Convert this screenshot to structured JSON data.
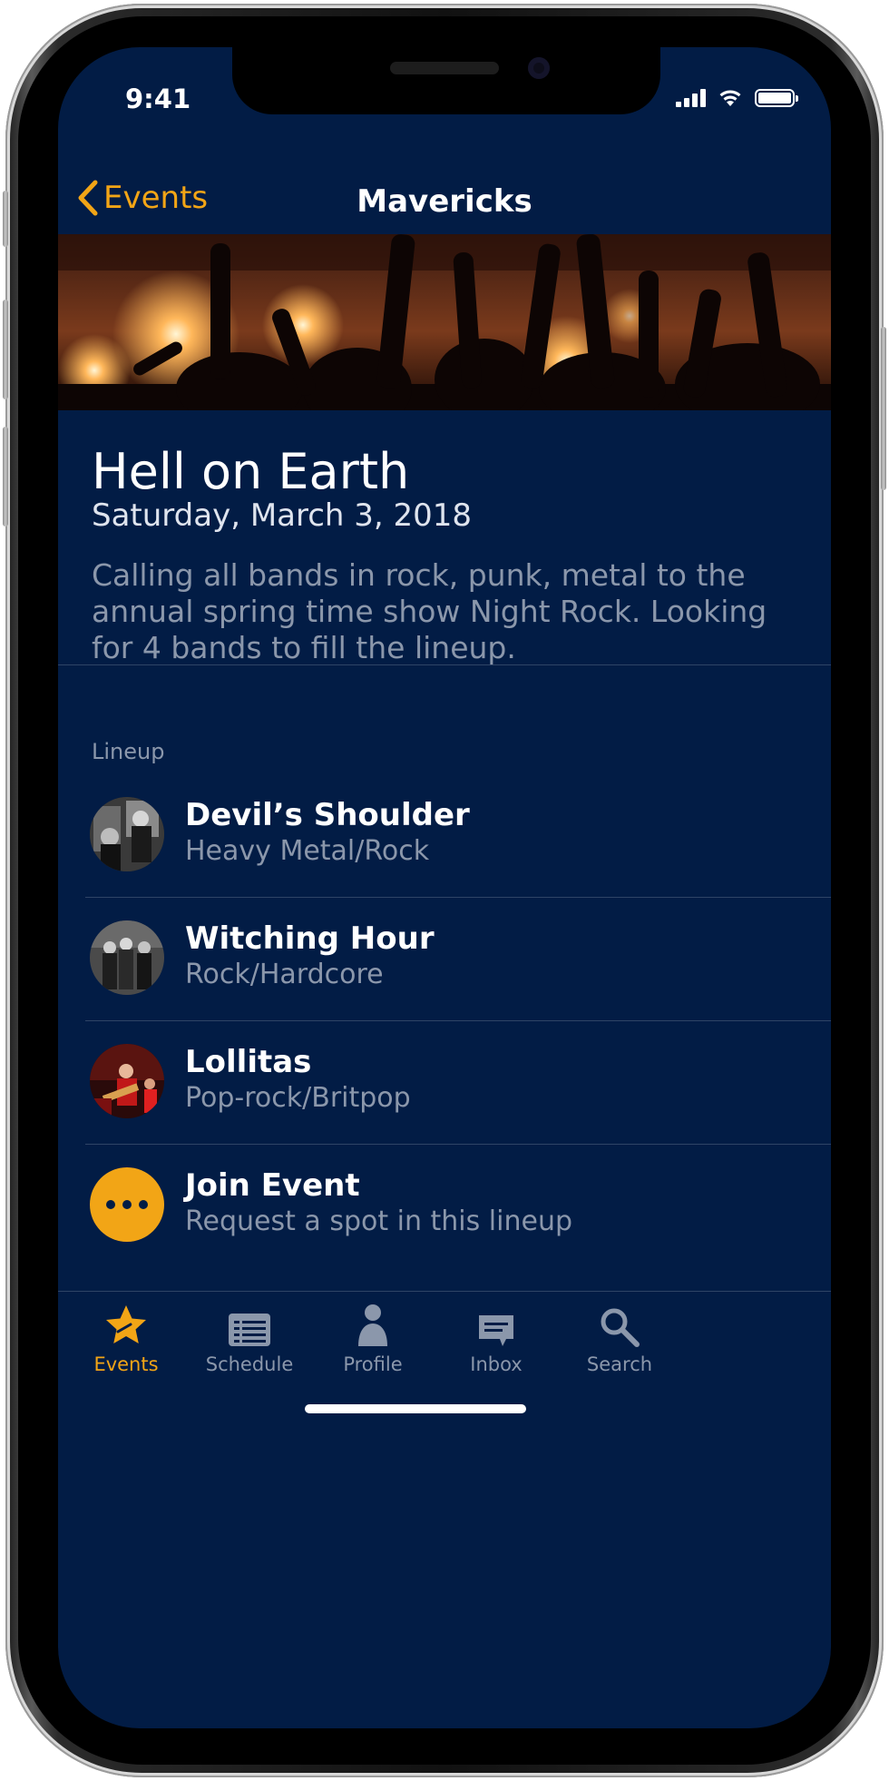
{
  "status": {
    "time": "9:41"
  },
  "nav": {
    "back_label": "Events",
    "title": "Mavericks"
  },
  "event": {
    "title": "Hell on Earth",
    "date": "Saturday, March 3, 2018",
    "description": "Calling all bands in rock, punk, metal to the annual spring time show Night Rock. Looking for 4 bands to fill the lineup."
  },
  "lineup": {
    "label": "Lineup",
    "items": [
      {
        "name": "Devil’s Shoulder",
        "genre": "Heavy Metal/Rock"
      },
      {
        "name": "Witching Hour",
        "genre": "Rock/Hardcore"
      },
      {
        "name": "Lollitas",
        "genre": "Pop-rock/Britpop"
      }
    ],
    "join": {
      "name": "Join Event",
      "subtitle": "Request a spot in this lineup"
    }
  },
  "tabs": [
    {
      "label": "Events",
      "icon": "star-icon",
      "active": true
    },
    {
      "label": "Schedule",
      "icon": "schedule-icon"
    },
    {
      "label": "Profile",
      "icon": "person-icon"
    },
    {
      "label": "Inbox",
      "icon": "inbox-icon"
    },
    {
      "label": "Search",
      "icon": "search-icon"
    }
  ],
  "colors": {
    "background": "#021c45",
    "accent": "#f2a516",
    "secondary_text": "#8b97ab"
  }
}
